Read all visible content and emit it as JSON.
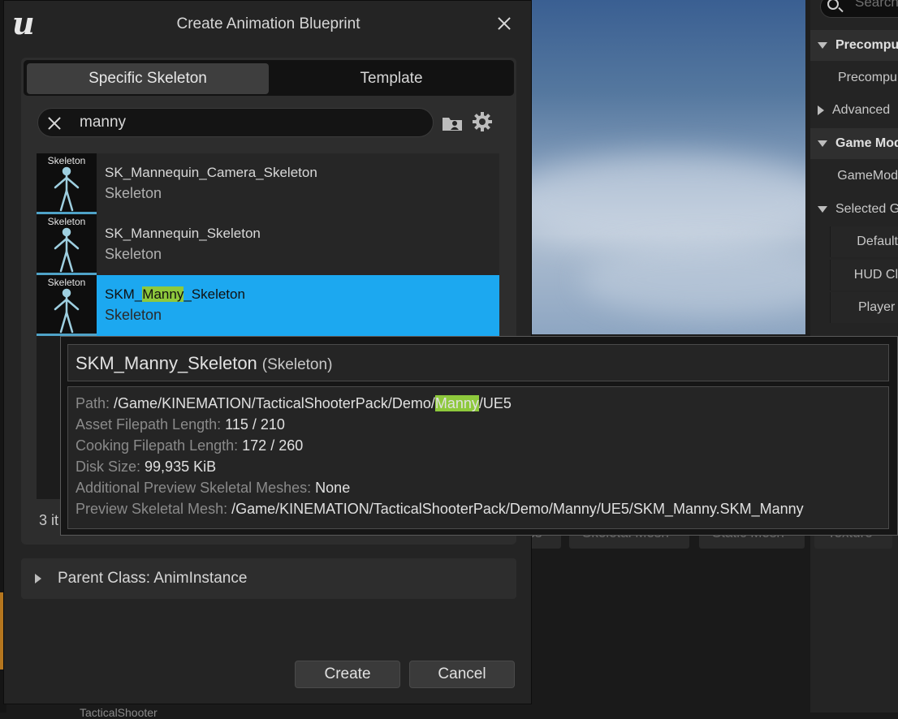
{
  "dialog": {
    "title": "Create Animation Blueprint",
    "tabs": [
      {
        "label": "Specific Skeleton",
        "active": true
      },
      {
        "label": "Template",
        "active": false
      }
    ],
    "search": {
      "value": "manny"
    },
    "assets": [
      {
        "thumb_label": "Skeleton",
        "name": "SK_Mannequin_Camera_Skeleton",
        "type": "Skeleton",
        "selected": false
      },
      {
        "thumb_label": "Skeleton",
        "name": "SK_Mannequin_Skeleton",
        "type": "Skeleton",
        "selected": false
      },
      {
        "thumb_label": "Skeleton",
        "name_prefix": "SKM_",
        "name_match": "Manny",
        "name_suffix": "_Skeleton",
        "type": "Skeleton",
        "selected": true
      }
    ],
    "count_text": "3 it",
    "parent_class": "Parent Class: AnimInstance",
    "create_label": "Create",
    "cancel_label": "Cancel"
  },
  "tooltip": {
    "name": "SKM_Manny_Skeleton",
    "type": "(Skeleton)",
    "path_label": "Path:",
    "path_prefix": "/Game/KINEMATION/TacticalShooterPack/Demo/",
    "path_match": "Manny",
    "path_suffix": "/UE5",
    "asset_len_label": "Asset Filepath Length:",
    "asset_len_value": "115 / 210",
    "cook_len_label": "Cooking Filepath Length:",
    "cook_len_value": "172 / 260",
    "disk_label": "Disk Size:",
    "disk_value": "99,935 KiB",
    "addl_label": "Additional Preview Skeletal Meshes:",
    "addl_value": "None",
    "preview_label": "Preview Skeletal Mesh:",
    "preview_value": "/Game/KINEMATION/TacticalShooterPack/Demo/Manny/UE5/SKM_Manny.SKM_Manny"
  },
  "details": {
    "search_placeholder": "Search",
    "rows": [
      {
        "label": "Precompu",
        "kind": "category",
        "arrow": "down"
      },
      {
        "label": "Precompu",
        "kind": "item"
      },
      {
        "label": "Advanced",
        "kind": "item",
        "arrow": "right"
      },
      {
        "label": "Game Mod",
        "kind": "category",
        "arrow": "down"
      },
      {
        "label": "GameMod",
        "kind": "item"
      },
      {
        "label": "Selected G",
        "kind": "item",
        "arrow": "down"
      },
      {
        "label": "Default",
        "kind": "sub"
      },
      {
        "label": "HUD Cl",
        "kind": "sub"
      },
      {
        "label": "Player",
        "kind": "sub"
      }
    ]
  },
  "filters": [
    "ass",
    "Skeletal Mesh",
    "Static Mesh",
    "Texture"
  ],
  "background_stub": "TacticalShooter",
  "colors": {
    "selection": "#1ca8f0",
    "highlight": "#8ec93c",
    "panel": "#242424"
  }
}
